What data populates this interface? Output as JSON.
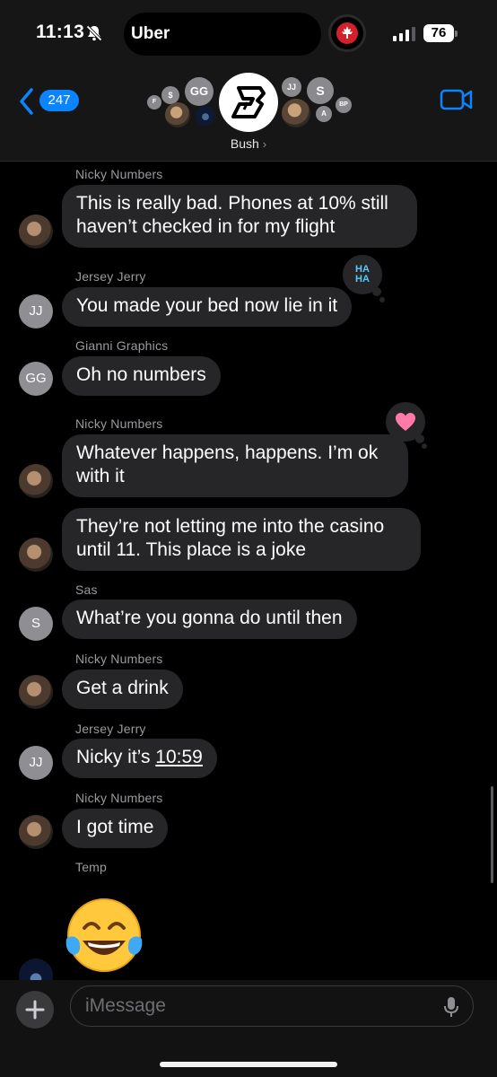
{
  "status_bar": {
    "time": "11:13",
    "island_app": "Uber",
    "battery": "76"
  },
  "header": {
    "back_count": "247",
    "group_name": "Bush",
    "participants": [
      "F",
      "$",
      "GG",
      "JJ",
      "S",
      "BP",
      "A"
    ]
  },
  "messages": [
    {
      "sender": "Nicky  Numbers",
      "text_lines": [
        "This is really bad. Phones at 10% still",
        "haven’t checked in for my flight"
      ],
      "avatar": "photo"
    },
    {
      "sender": "Jersey  Jerry",
      "text": "You made your bed now lie in it",
      "avatar_initials": "JJ",
      "tapback": "haha"
    },
    {
      "sender": "Gianni Graphics",
      "text": "Oh no numbers",
      "avatar_initials": "GG"
    },
    {
      "sender": "Nicky  Numbers",
      "text_lines": [
        "Whatever happens, happens. I’m ok",
        "with it"
      ],
      "avatar": "photo",
      "tapback": "heart"
    },
    {
      "text_lines": [
        "They’re not letting me into the casino",
        "until 11. This place is a joke"
      ],
      "avatar": "photo"
    },
    {
      "sender": "Sas",
      "text": "What’re you gonna do until then",
      "avatar_initials": "S"
    },
    {
      "sender": "Nicky  Numbers",
      "text": "Get a drink",
      "avatar": "photo"
    },
    {
      "sender": "Jersey  Jerry",
      "text_prefix": "Nicky it’s ",
      "text_link": "10:59",
      "avatar_initials": "JJ"
    },
    {
      "sender": "Nicky  Numbers",
      "text": "I got time",
      "avatar": "photo"
    },
    {
      "sender": "Temp",
      "emoji": "face-with-tears-of-joy",
      "avatar": "night"
    }
  ],
  "tapback_haha": [
    "HA",
    "HA"
  ],
  "input": {
    "placeholder": "iMessage"
  },
  "colors": {
    "accent": "#0a84ff",
    "bubble": "#262628",
    "background": "#000000"
  }
}
